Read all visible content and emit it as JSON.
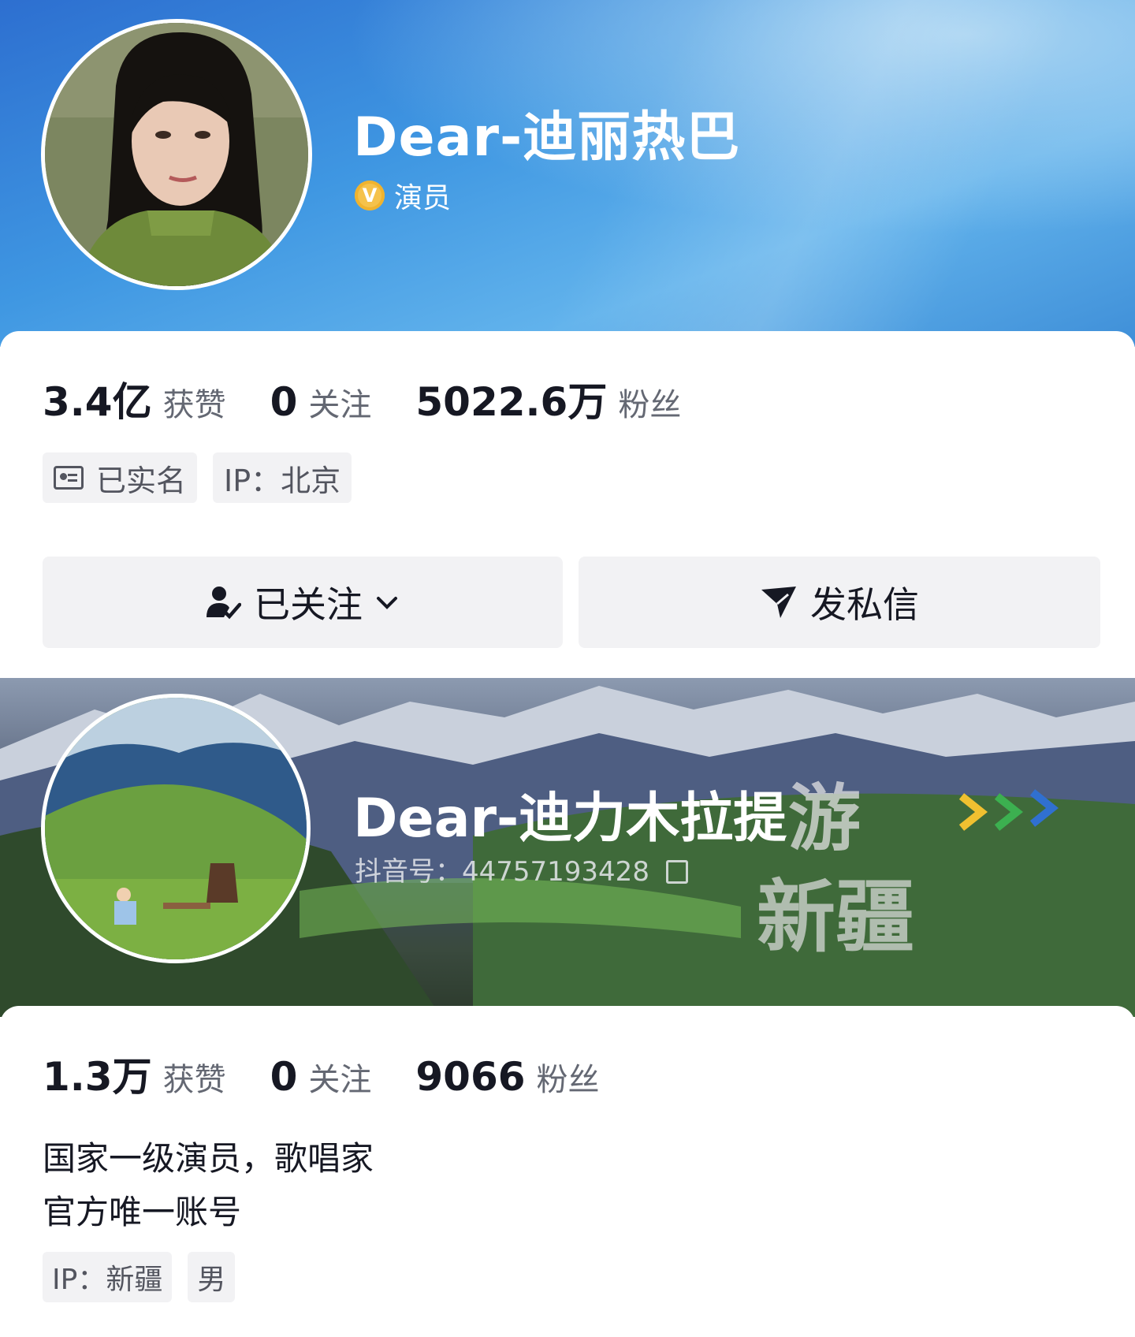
{
  "profile1": {
    "name": "Dear-迪丽热巴",
    "verified_label": "演员",
    "verify_icon": "v-badge-icon",
    "stats": [
      {
        "value": "3.4亿",
        "label": "获赞"
      },
      {
        "value": "0",
        "label": "关注"
      },
      {
        "value": "5022.6万",
        "label": "粉丝"
      }
    ],
    "tags": [
      "已实名",
      "IP：北京"
    ],
    "follow_button": "已关注",
    "message_button": "发私信",
    "colors": {
      "header": "#3f97e2",
      "verify": "#f5c24b"
    }
  },
  "profile2": {
    "name": "Dear-迪力木拉提",
    "douyin_id": "抖音号：44757193428",
    "banner_text": [
      "游",
      "新疆"
    ],
    "stats": [
      {
        "value": "1.3万",
        "label": "获赞"
      },
      {
        "value": "0",
        "label": "关注"
      },
      {
        "value": "9066",
        "label": "粉丝"
      }
    ],
    "bio": [
      "国家一级演员，歌唱家",
      "官方唯一账号"
    ],
    "tags": [
      "IP：新疆",
      "男"
    ]
  }
}
